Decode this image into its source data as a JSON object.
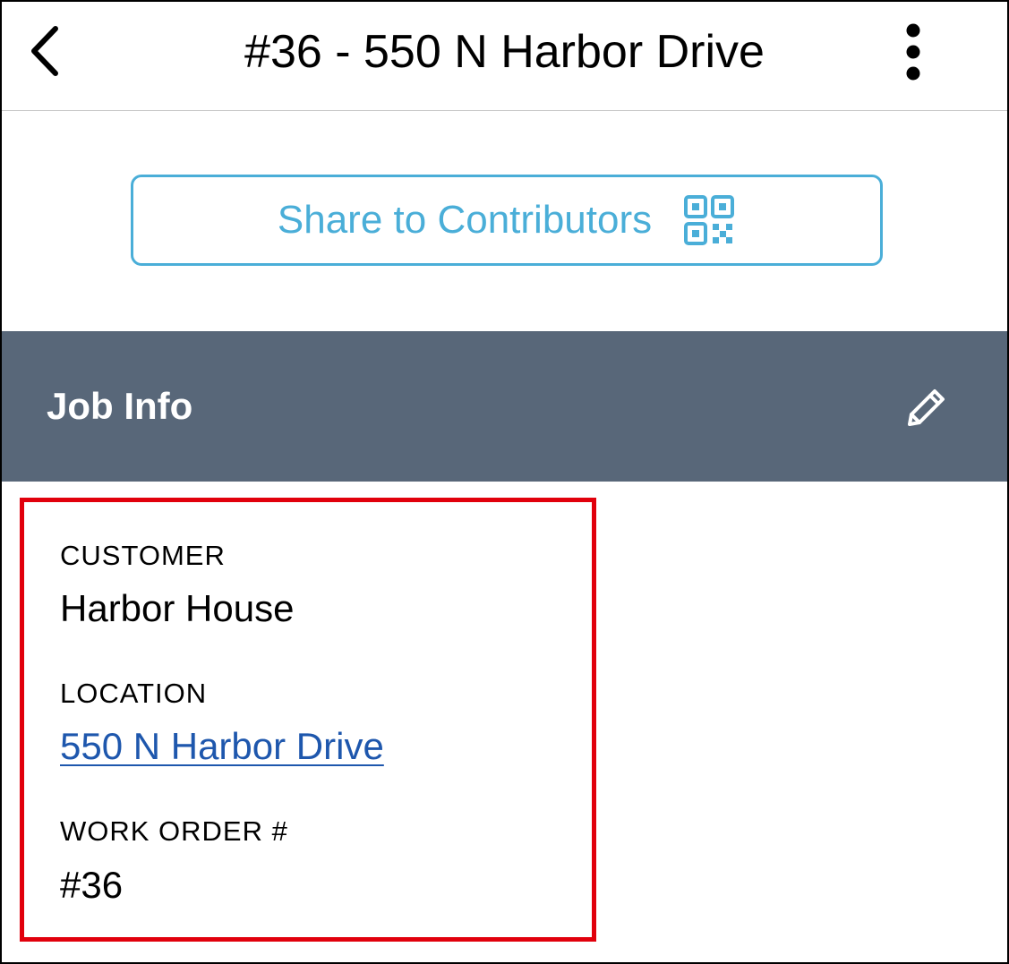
{
  "navbar": {
    "title": "#36 - 550 N Harbor Drive",
    "back_icon": "chevron-left-icon",
    "more_icon": "more-vertical-icon"
  },
  "share": {
    "label": "Share to Contributors",
    "icon": "qr-code-icon",
    "color": "#4aaed8"
  },
  "section": {
    "title": "Job Info",
    "edit_icon": "pencil-icon",
    "background": "#586779"
  },
  "job_info": {
    "highlight_color": "#e1000c",
    "customer_label": "CUSTOMER",
    "customer_value": "Harbor House",
    "location_label": "LOCATION",
    "location_value": "550 N Harbor Drive",
    "location_link_color": "#1e57ad",
    "work_order_label": "WORK ORDER #",
    "work_order_value": "#36"
  }
}
